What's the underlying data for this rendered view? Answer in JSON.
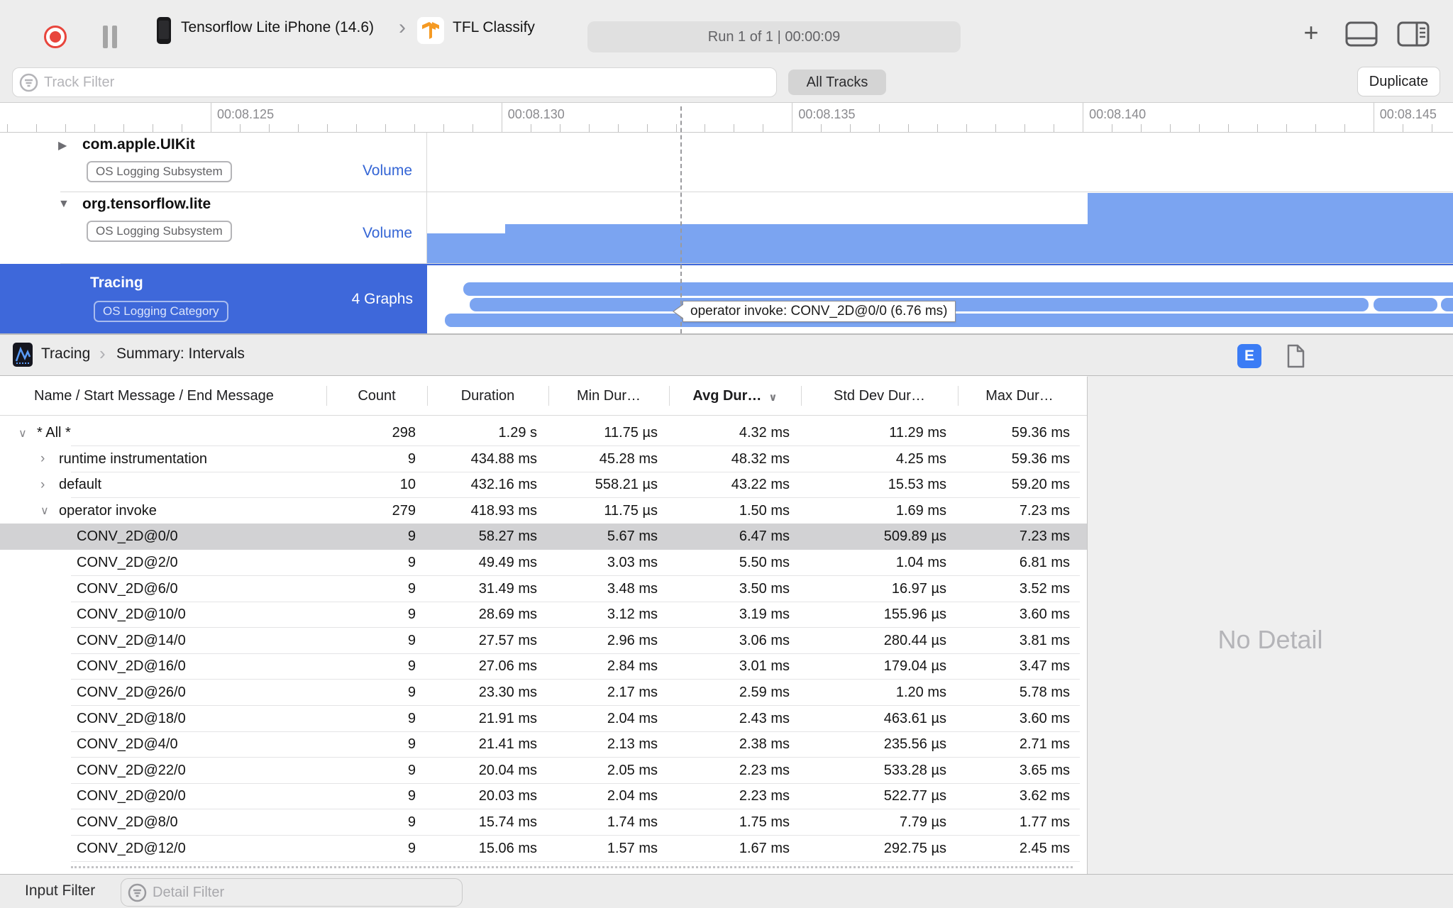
{
  "toolbar": {
    "device_name": "Tensorflow Lite iPhone (14.6)",
    "breadcrumb_chevron": "›",
    "target_name": "TFL Classify",
    "run_info": "Run 1 of 1  |  00:00:09"
  },
  "filter_bar": {
    "track_filter_placeholder": "Track Filter",
    "all_tracks_label": "All Tracks",
    "duplicate_label": "Duplicate"
  },
  "ruler": {
    "labels": [
      "00:08.125",
      "00:08.130",
      "00:08.135",
      "00:08.140",
      "00:08.145"
    ]
  },
  "tracks": [
    {
      "name": "com.apple.UIKit",
      "badge": "OS Logging Subsystem",
      "value_label": "Volume",
      "disclosure": "▶"
    },
    {
      "name": "org.tensorflow.lite",
      "badge": "OS Logging Subsystem",
      "value_label": "Volume",
      "disclosure": "▼"
    },
    {
      "name": "Tracing",
      "badge": "OS Logging Category",
      "value_label": "4 Graphs",
      "disclosure": ""
    }
  ],
  "tooltip": {
    "text": "operator invoke: CONV_2D@0/0 (6.76 ms)"
  },
  "detail_header": {
    "instrument": "Tracing",
    "chevron": "›",
    "summary": "Summary: Intervals",
    "e_badge": "E"
  },
  "table": {
    "columns": [
      "Name / Start Message / End Message",
      "Count",
      "Duration",
      "Min Dur…",
      "Avg Dur…",
      "Std Dev Dur…",
      "Max Dur…"
    ],
    "sort_indicator": "∨",
    "rows": [
      {
        "name": "* All *",
        "indent": 0,
        "disclosure": "open",
        "selected": false,
        "count": "298",
        "duration": "1.29 s",
        "min": "11.75 µs",
        "avg": "4.32 ms",
        "std": "11.29 ms",
        "max": "59.36 ms"
      },
      {
        "name": "runtime instrumentation",
        "indent": 1,
        "disclosure": "closed",
        "selected": false,
        "count": "9",
        "duration": "434.88 ms",
        "min": "45.28 ms",
        "avg": "48.32 ms",
        "std": "4.25 ms",
        "max": "59.36 ms"
      },
      {
        "name": "default",
        "indent": 1,
        "disclosure": "closed",
        "selected": false,
        "count": "10",
        "duration": "432.16 ms",
        "min": "558.21 µs",
        "avg": "43.22 ms",
        "std": "15.53 ms",
        "max": "59.20 ms"
      },
      {
        "name": "operator invoke",
        "indent": 1,
        "disclosure": "open",
        "selected": false,
        "count": "279",
        "duration": "418.93 ms",
        "min": "11.75 µs",
        "avg": "1.50 ms",
        "std": "1.69 ms",
        "max": "7.23 ms"
      },
      {
        "name": "CONV_2D@0/0",
        "indent": 2,
        "disclosure": "",
        "selected": true,
        "count": "9",
        "duration": "58.27 ms",
        "min": "5.67 ms",
        "avg": "6.47 ms",
        "std": "509.89 µs",
        "max": "7.23 ms"
      },
      {
        "name": "CONV_2D@2/0",
        "indent": 2,
        "disclosure": "",
        "selected": false,
        "count": "9",
        "duration": "49.49 ms",
        "min": "3.03 ms",
        "avg": "5.50 ms",
        "std": "1.04 ms",
        "max": "6.81 ms"
      },
      {
        "name": "CONV_2D@6/0",
        "indent": 2,
        "disclosure": "",
        "selected": false,
        "count": "9",
        "duration": "31.49 ms",
        "min": "3.48 ms",
        "avg": "3.50 ms",
        "std": "16.97 µs",
        "max": "3.52 ms"
      },
      {
        "name": "CONV_2D@10/0",
        "indent": 2,
        "disclosure": "",
        "selected": false,
        "count": "9",
        "duration": "28.69 ms",
        "min": "3.12 ms",
        "avg": "3.19 ms",
        "std": "155.96 µs",
        "max": "3.60 ms"
      },
      {
        "name": "CONV_2D@14/0",
        "indent": 2,
        "disclosure": "",
        "selected": false,
        "count": "9",
        "duration": "27.57 ms",
        "min": "2.96 ms",
        "avg": "3.06 ms",
        "std": "280.44 µs",
        "max": "3.81 ms"
      },
      {
        "name": "CONV_2D@16/0",
        "indent": 2,
        "disclosure": "",
        "selected": false,
        "count": "9",
        "duration": "27.06 ms",
        "min": "2.84 ms",
        "avg": "3.01 ms",
        "std": "179.04 µs",
        "max": "3.47 ms"
      },
      {
        "name": "CONV_2D@26/0",
        "indent": 2,
        "disclosure": "",
        "selected": false,
        "count": "9",
        "duration": "23.30 ms",
        "min": "2.17 ms",
        "avg": "2.59 ms",
        "std": "1.20 ms",
        "max": "5.78 ms"
      },
      {
        "name": "CONV_2D@18/0",
        "indent": 2,
        "disclosure": "",
        "selected": false,
        "count": "9",
        "duration": "21.91 ms",
        "min": "2.04 ms",
        "avg": "2.43 ms",
        "std": "463.61 µs",
        "max": "3.60 ms"
      },
      {
        "name": "CONV_2D@4/0",
        "indent": 2,
        "disclosure": "",
        "selected": false,
        "count": "9",
        "duration": "21.41 ms",
        "min": "2.13 ms",
        "avg": "2.38 ms",
        "std": "235.56 µs",
        "max": "2.71 ms"
      },
      {
        "name": "CONV_2D@22/0",
        "indent": 2,
        "disclosure": "",
        "selected": false,
        "count": "9",
        "duration": "20.04 ms",
        "min": "2.05 ms",
        "avg": "2.23 ms",
        "std": "533.28 µs",
        "max": "3.65 ms"
      },
      {
        "name": "CONV_2D@20/0",
        "indent": 2,
        "disclosure": "",
        "selected": false,
        "count": "9",
        "duration": "20.03 ms",
        "min": "2.04 ms",
        "avg": "2.23 ms",
        "std": "522.77 µs",
        "max": "3.62 ms"
      },
      {
        "name": "CONV_2D@8/0",
        "indent": 2,
        "disclosure": "",
        "selected": false,
        "count": "9",
        "duration": "15.74 ms",
        "min": "1.74 ms",
        "avg": "1.75 ms",
        "std": "7.79 µs",
        "max": "1.77 ms"
      },
      {
        "name": "CONV_2D@12/0",
        "indent": 2,
        "disclosure": "",
        "selected": false,
        "count": "9",
        "duration": "15.06 ms",
        "min": "1.57 ms",
        "avg": "1.67 ms",
        "std": "292.75 µs",
        "max": "2.45 ms"
      }
    ]
  },
  "detail_pane": {
    "empty_text": "No Detail"
  },
  "bottom_bar": {
    "label": "Input Filter",
    "detail_filter_placeholder": "Detail Filter"
  },
  "colors": {
    "accent_blue": "#3465d5",
    "selected_track_blue": "#3e68da",
    "graph_bar_blue": "#7ba4f1",
    "record_red": "#e8453c",
    "e_badge_blue": "#3b7cf5",
    "selected_row_gray": "#d2d2d4"
  }
}
